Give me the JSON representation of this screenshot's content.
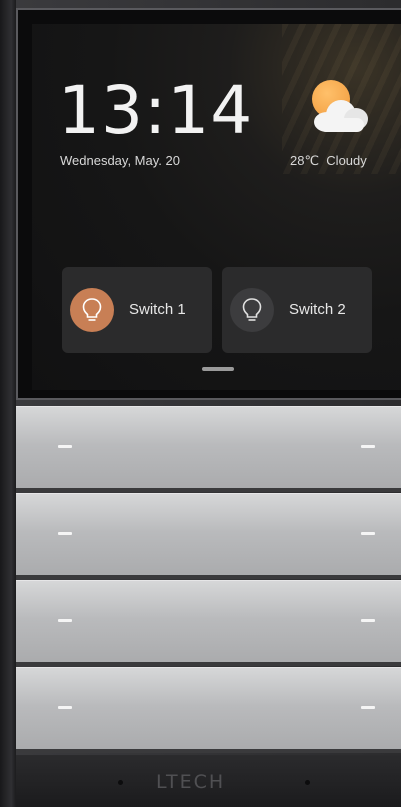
{
  "clock": {
    "time": "13:14",
    "date": "Wednesday, May. 20"
  },
  "weather": {
    "temperature": "28℃",
    "condition": "Cloudy",
    "icon": "partly-cloudy-icon"
  },
  "switches": [
    {
      "label": "Switch 1",
      "icon": "lightbulb-icon",
      "state": "on",
      "accent": "#c87f55"
    },
    {
      "label": "Switch 2",
      "icon": "lightbulb-icon",
      "state": "off",
      "accent": "#3c3c3e"
    }
  ],
  "brand": "LTECH",
  "panels": [
    "button-1",
    "button-2",
    "button-3",
    "button-4"
  ]
}
